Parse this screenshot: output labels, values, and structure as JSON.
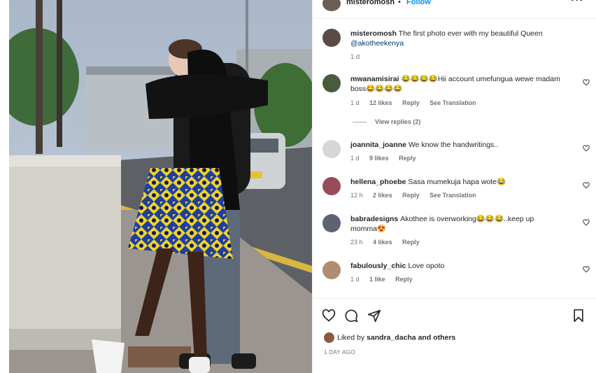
{
  "post": {
    "username": "misteromosh",
    "separator": "•",
    "follow_label": "Follow",
    "more_label": "···"
  },
  "caption": {
    "username": "misteromosh",
    "text": "The first photo ever with my beautiful Queen",
    "mention": "@akotheekenya",
    "time": "1 d"
  },
  "comments": [
    {
      "username": "mwanamisirai",
      "text": "😂😂😂😂Hii account umefungua wewe madam boss😂😂😂😂",
      "time": "1 d",
      "likes": "12 likes",
      "reply": "Reply",
      "translate": "See Translation"
    },
    {
      "username": "joannita_joanne",
      "text": "We know the handwritings..",
      "time": "1 d",
      "likes": "9 likes",
      "reply": "Reply",
      "translate": ""
    },
    {
      "username": "hellena_phoebe",
      "text": "Sasa mumekuja hapa wote😂",
      "time": "12 h",
      "likes": "2 likes",
      "reply": "Reply",
      "translate": "See Translation"
    },
    {
      "username": "babradesigns",
      "text": "Akothee is overworking😂😂😂..keep up momma😍",
      "time": "23 h",
      "likes": "4 likes",
      "reply": "Reply",
      "translate": ""
    },
    {
      "username": "fabulously_chic",
      "text": "Love opoto",
      "time": "1 d",
      "likes": "1 like",
      "reply": "Reply",
      "translate": ""
    }
  ],
  "view_replies": "View replies (2)",
  "likes_summary": {
    "prefix": "Liked by ",
    "user": "sandra_dacha",
    "suffix": " and others"
  },
  "posted_ago": "1 DAY AGO",
  "icons": [
    "heart-icon",
    "comment-icon",
    "share-icon",
    "bookmark-icon",
    "more-icon"
  ],
  "colors": {
    "link": "#0095f6",
    "mention": "#00376b",
    "muted": "#737373"
  }
}
